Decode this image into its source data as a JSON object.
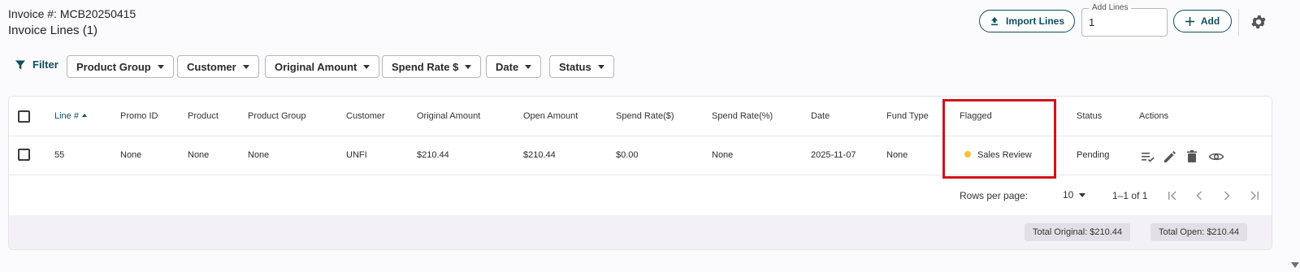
{
  "header": {
    "invoice_number": "Invoice #: MCB20250415",
    "section_title": "Invoice Lines (1)"
  },
  "toolbar": {
    "import_label": "Import Lines",
    "add_lines_legend": "Add Lines",
    "add_lines_value": "1",
    "add_label": "Add"
  },
  "filters": {
    "label": "Filter",
    "chips": [
      "Product Group",
      "Customer",
      "Original Amount",
      "Spend Rate $",
      "Date",
      "Status"
    ]
  },
  "table": {
    "columns": [
      "Line #",
      "Promo ID",
      "Product",
      "Product Group",
      "Customer",
      "Original Amount",
      "Open Amount",
      "Spend Rate($)",
      "Spend Rate(%)",
      "Date",
      "Fund Type",
      "Flagged",
      "Status",
      "Actions"
    ],
    "rows": [
      {
        "line": "55",
        "promo_id": "None",
        "product": "None",
        "product_group": "None",
        "customer": "UNFI",
        "original_amount": "$210.44",
        "open_amount": "$210.44",
        "spend_rate_dollar": "$0.00",
        "spend_rate_pct": "None",
        "date": "2025-11-07",
        "fund_type": "None",
        "flagged": "Sales Review",
        "status": "Pending"
      }
    ],
    "flag_color": "#f5c430"
  },
  "pagination": {
    "rows_per_page_label": "Rows per page:",
    "rows_per_page_value": "10",
    "range": "1–1 of 1"
  },
  "totals": {
    "original": "Total Original: $210.44",
    "open": "Total Open: $210.44"
  },
  "colors": {
    "accent": "#0f4f5c",
    "highlight": "#d0131a"
  }
}
